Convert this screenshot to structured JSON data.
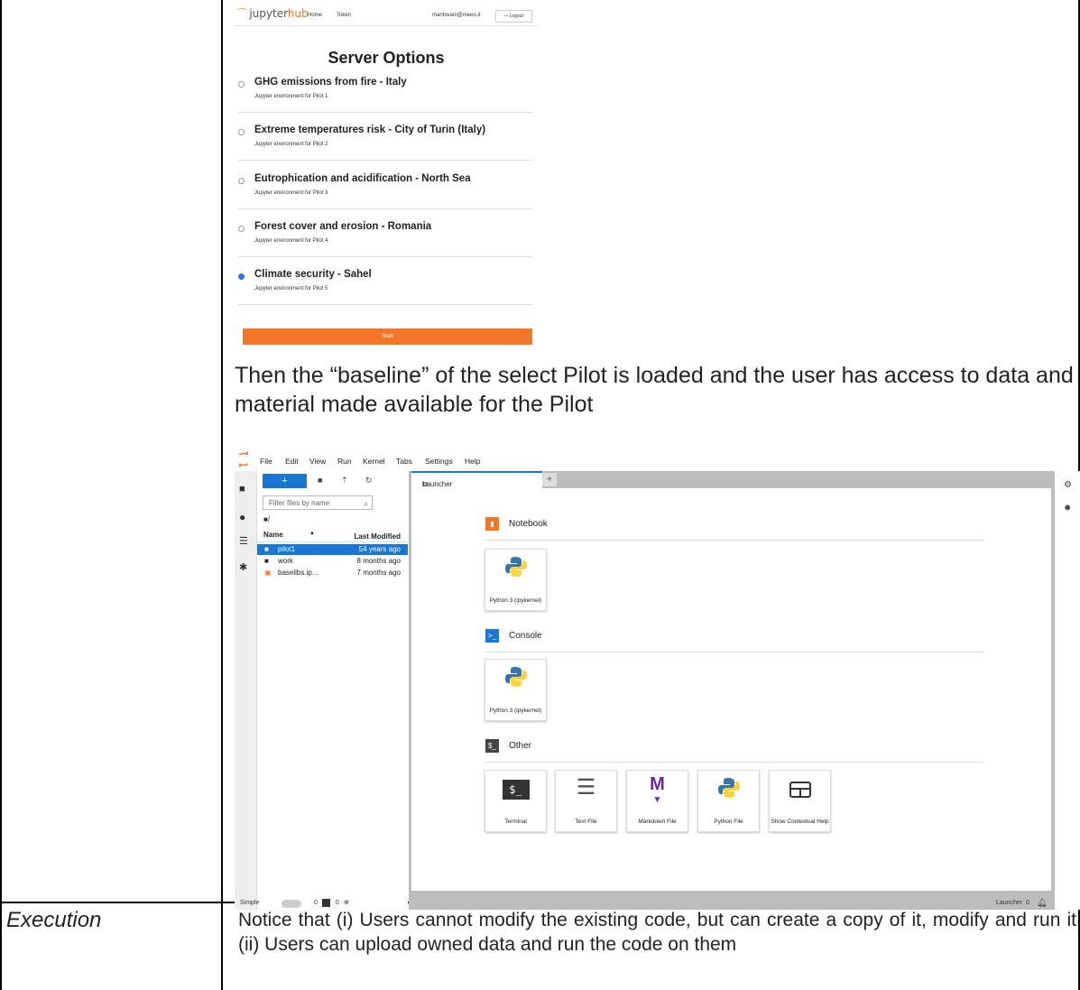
{
  "hub": {
    "logo_text": "jupyter",
    "logo_hub": "hub",
    "nav_home": "Home",
    "nav_token": "Token",
    "user": "mantovani@meeo.it",
    "logout": "Logout",
    "title": "Server Options",
    "options": [
      {
        "label": "GHG emissions from fire - Italy",
        "desc": "Jupyter environment for Pilot 1",
        "selected": false
      },
      {
        "label": "Extreme temperatures risk - City of Turin (Italy)",
        "desc": "Jupyter environment for Pilot 2",
        "selected": false
      },
      {
        "label": "Eutrophication and acidification - North Sea",
        "desc": "Jupyter environment for Pilot 3",
        "selected": false
      },
      {
        "label": "Forest cover and erosion - Romania",
        "desc": "Jupyter environment for Pilot 4",
        "selected": false
      },
      {
        "label": "Climate security - Sahel",
        "desc": "Jupyter environment for Pilot 5",
        "selected": true
      }
    ],
    "start": "Start",
    "accent": "#f37726"
  },
  "paragraph": "Then the “baseline” of the select Pilot is loaded and the user has access to data and material made available for the Pilot",
  "lab": {
    "menu": [
      "File",
      "Edit",
      "View",
      "Run",
      "Kernel",
      "Tabs",
      "Settings",
      "Help"
    ],
    "new_label": "+",
    "filter_placeholder": "Filter files by name",
    "crumb": "/",
    "col_name": "Name",
    "col_modified": "Last Modified",
    "files": [
      {
        "name": "pilot1",
        "modified": "54 years ago",
        "selected": true
      },
      {
        "name": "work",
        "modified": "8 months ago",
        "selected": false
      },
      {
        "name": "baselibs.ip...",
        "modified": "7 months ago",
        "selected": false
      }
    ],
    "tab_label": "Launcher",
    "sections": {
      "notebook": "Notebook",
      "console": "Console",
      "other": "Other"
    },
    "kernel_card": "Python 3 (ipykernel)",
    "other_cards": [
      "Terminal",
      "Text File",
      "Markdown File",
      "Python File",
      "Show Contextual Help"
    ],
    "status_simple": "Simple",
    "status_counts": [
      "0",
      "0"
    ],
    "status_right": "Launcher",
    "status_right_count": "0",
    "accent": "#1976d2"
  },
  "execution": {
    "label": "Execution",
    "text": "Notice that (i) Users cannot modify the existing code, but can create a copy of it, modify and run it (ii) Users can upload owned data and run the code on them"
  }
}
